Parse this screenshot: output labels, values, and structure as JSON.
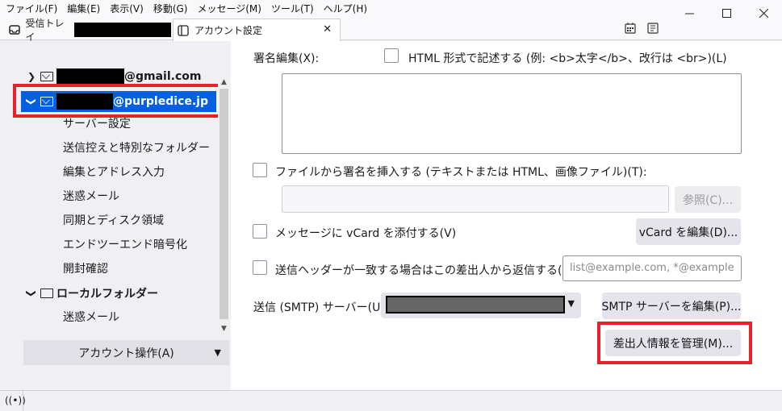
{
  "menubar": {
    "items": [
      "ファイル(F)",
      "編集(E)",
      "表示(V)",
      "移動(G)",
      "メッセージ(M)",
      "ツール(T)",
      "ヘルプ(H)"
    ]
  },
  "window": {
    "minimize_icon": "minimize-icon",
    "maximize_icon": "maximize-icon",
    "close_icon": "close-icon"
  },
  "tabs": {
    "inbox_label": "受信トレイ",
    "settings_label": "アカウント設定",
    "close_glyph": "✕"
  },
  "sidebar": {
    "accounts": [
      {
        "suffix": "@gmail.com",
        "expanded": false
      },
      {
        "suffix": "@purpledice.jp",
        "expanded": true,
        "selected": true
      }
    ],
    "sub_items": [
      "サーバー設定",
      "送信控えと特別なフォルダー",
      "編集とアドレス入力",
      "迷惑メール",
      "同期とディスク領域",
      "エンドツーエンド暗号化",
      "開封確認"
    ],
    "local_folders": "ローカルフォルダー",
    "local_sub_items": [
      "迷惑メール"
    ],
    "account_actions": "アカウント操作(A)"
  },
  "main": {
    "signature_label": "署名編集(X):",
    "html_checkbox_label": "HTML 形式で記述する (例: <b>太字</b>、改行は <br>)(L)",
    "file_signature_label": "ファイルから署名を挿入する (テキストまたは HTML、画像ファイル)(T):",
    "browse_button": "参照(C)...",
    "vcard_label": "メッセージに vCard を添付する(V)",
    "vcard_button": "vCard を編集(D)...",
    "reply_header_label": "送信ヘッダーが一致する場合はこの差出人から返信する(D):",
    "reply_header_placeholder": "list@example.com, *@example",
    "smtp_label": "送信 (SMTP) サーバー(U):",
    "smtp_button": "SMTP サーバーを編集(P)...",
    "manage_identities_button": "差出人情報を管理(M)..."
  },
  "colors": {
    "selection": "#0060df",
    "highlight": "#e8202a"
  }
}
